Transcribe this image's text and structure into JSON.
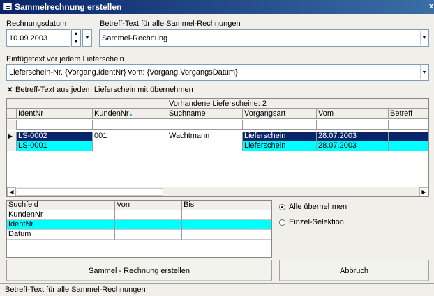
{
  "window": {
    "title": "Sammelrechnung erstellen",
    "close": "x"
  },
  "form": {
    "date_label": "Rechnungsdatum",
    "date_value": "10.09.2003",
    "subject_label": "Betreff-Text für alle Sammel-Rechnungen",
    "subject_value": "Sammel-Rechnung",
    "insert_label": "Einfügetext vor jedem Lieferschein",
    "insert_value": "Lieferschein-Nr. {Vorgang.IdentNr} vom: {Vorgang.VorgangsDatum}",
    "checkbox_label": "Betreff-Text aus jedem Lieferschein mit übernehmen",
    "checkbox_checked": true
  },
  "grid": {
    "caption": "Vorhandene Lieferscheine: 2",
    "columns": [
      "IdentNr",
      "KundenNr",
      "Suchname",
      "Vorgangsart",
      "Vom",
      "Betreff"
    ],
    "sort_indicator": "▲",
    "rows": [
      {
        "IdentNr": "LS-0002",
        "KundenNr": "001",
        "Suchname": "Wachtmann",
        "Vorgangsart": "Lieferschein",
        "Vom": "28.07.2003",
        "Betreff": ""
      },
      {
        "IdentNr": "LS-0001",
        "KundenNr": "",
        "Suchname": "",
        "Vorgangsart": "Lieferschein",
        "Vom": "28.07.2003",
        "Betreff": ""
      }
    ],
    "row_indicator": "▶"
  },
  "search": {
    "columns": [
      "Suchfeld",
      "Von",
      "Bis"
    ],
    "rows": [
      "KundenNr",
      "IdentNr",
      "Datum"
    ]
  },
  "options": {
    "all_label": "Alle übernehmen",
    "single_label": "Einzel-Selektion",
    "selected": "all"
  },
  "buttons": {
    "create": "Sammel - Rechnung erstellen",
    "cancel": "Abbruch"
  },
  "status": {
    "text": "Betreff-Text für alle Sammel-Rechnungen"
  },
  "colors": {
    "selected_dark": "#0a246a",
    "selected_cyan": "#00ffff",
    "title_start": "#0a246a",
    "title_end": "#3a6ea5"
  }
}
